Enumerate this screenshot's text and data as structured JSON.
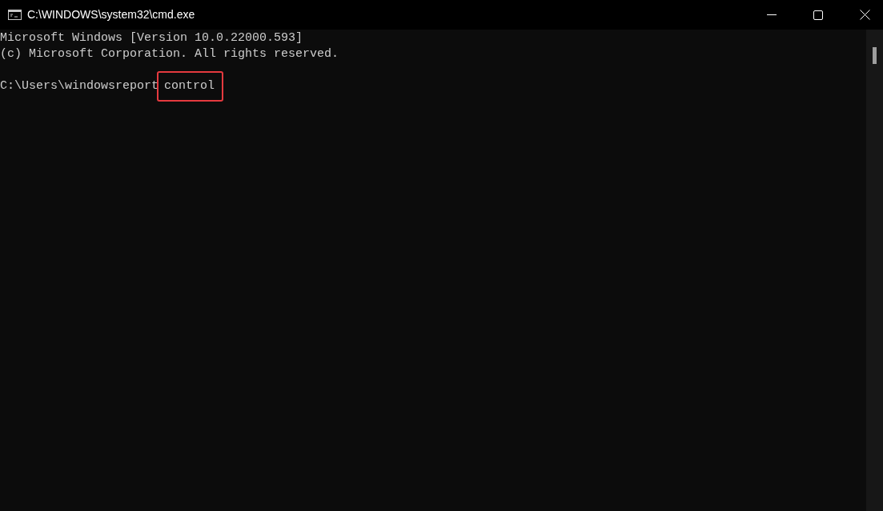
{
  "window": {
    "title": "C:\\WINDOWS\\system32\\cmd.exe"
  },
  "console": {
    "lines": [
      {
        "kind": "output",
        "text": "Microsoft Windows [Version 10.0.22000.593]"
      },
      {
        "kind": "output",
        "text": "(c) Microsoft Corporation. All rights reserved."
      },
      {
        "kind": "blank"
      },
      {
        "kind": "prompt",
        "prompt": "C:\\Users\\windowsreport",
        "command": "control",
        "highlighted": true
      }
    ]
  }
}
